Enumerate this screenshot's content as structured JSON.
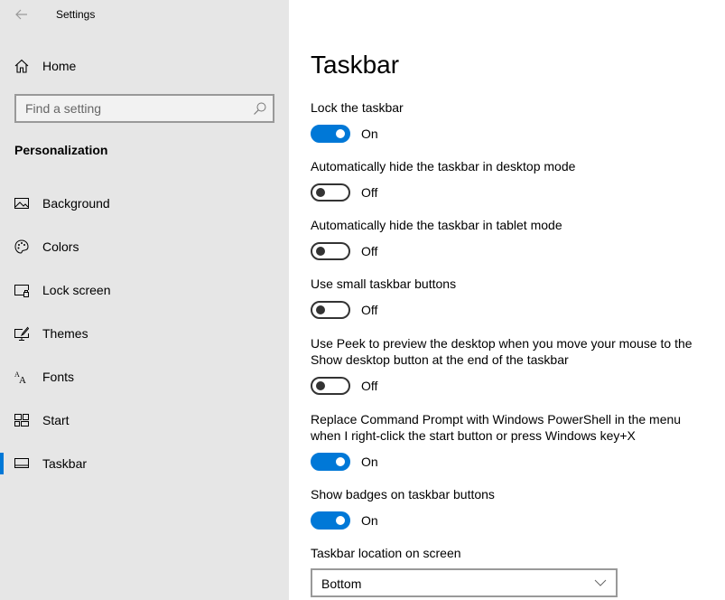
{
  "window": {
    "title": "Settings"
  },
  "sidebar": {
    "home_label": "Home",
    "search": {
      "placeholder": "Find a setting",
      "value": ""
    },
    "section_title": "Personalization",
    "items": [
      {
        "label": "Background",
        "icon": "picture-icon",
        "selected": false
      },
      {
        "label": "Colors",
        "icon": "palette-icon",
        "selected": false
      },
      {
        "label": "Lock screen",
        "icon": "lock-screen-icon",
        "selected": false
      },
      {
        "label": "Themes",
        "icon": "themes-icon",
        "selected": false
      },
      {
        "label": "Fonts",
        "icon": "fonts-icon",
        "selected": false
      },
      {
        "label": "Start",
        "icon": "start-icon",
        "selected": false
      },
      {
        "label": "Taskbar",
        "icon": "taskbar-icon",
        "selected": true
      }
    ]
  },
  "main": {
    "title": "Taskbar",
    "settings": [
      {
        "label": "Lock the taskbar",
        "state": "On"
      },
      {
        "label": "Automatically hide the taskbar in desktop mode",
        "state": "Off"
      },
      {
        "label": "Automatically hide the taskbar in tablet mode",
        "state": "Off"
      },
      {
        "label": "Use small taskbar buttons",
        "state": "Off"
      },
      {
        "label": "Use Peek to preview the desktop when you move your mouse to the Show desktop button at the end of the taskbar",
        "state": "Off"
      },
      {
        "label": "Replace Command Prompt with Windows PowerShell in the menu when I right-click the start button or press Windows key+X",
        "state": "On"
      },
      {
        "label": "Show badges on taskbar buttons",
        "state": "On"
      }
    ],
    "location": {
      "label": "Taskbar location on screen",
      "value": "Bottom"
    }
  },
  "colors": {
    "accent": "#0078d7",
    "sidebar_bg": "#e6e6e6"
  }
}
